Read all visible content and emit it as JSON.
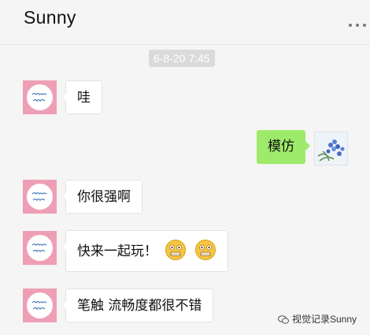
{
  "header": {
    "title": "Sunny",
    "more_icon": "more-dots-icon"
  },
  "timestamp": "6-8-20 7:45",
  "messages": [
    {
      "side": "in",
      "text": "哇"
    },
    {
      "side": "out",
      "text": "模仿"
    },
    {
      "side": "in",
      "text": "你很强啊"
    },
    {
      "side": "in",
      "text": "快来一起玩！",
      "emoji": [
        "grimace-emoji",
        "grimace-emoji"
      ]
    },
    {
      "side": "in",
      "text": "笔触 流畅度都很不错"
    }
  ],
  "contact_avatar": {
    "icon": "flower-script-avatar-icon",
    "color": "#ee9fb6"
  },
  "self_avatar": {
    "icon": "blue-flower-avatar-icon"
  },
  "watermark": {
    "text": "视觉记录Sunny",
    "icon": "wechat-channel-icon"
  },
  "colors": {
    "background": "#f5f5f5",
    "outgoing_bubble": "#9eea6a",
    "incoming_bubble": "#ffffff",
    "avatar_bg": "#ee9fb6"
  }
}
